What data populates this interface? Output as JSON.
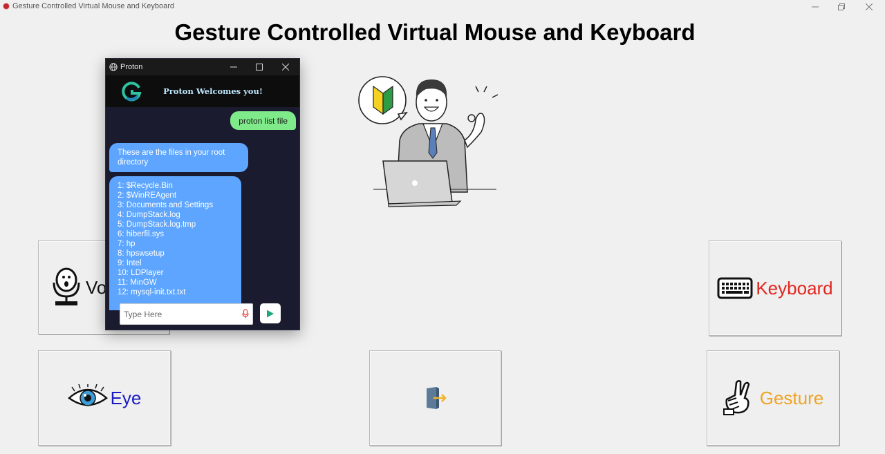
{
  "window": {
    "title": "Gesture Controlled Virtual Mouse and Keyboard",
    "controls": [
      "minimize",
      "restore",
      "close"
    ]
  },
  "main": {
    "heading": "Gesture Controlled Virtual Mouse and Keyboard",
    "tiles": {
      "voice": {
        "label": "Vo",
        "icon": "microphone-icon"
      },
      "keyboard": {
        "label": "Keyboard",
        "icon": "keyboard-icon",
        "color": "#e3261f"
      },
      "eye": {
        "label": "Eye",
        "icon": "eye-icon",
        "color": "#1c1cc4"
      },
      "exit": {
        "label": "",
        "icon": "exit-door-icon"
      },
      "gesture": {
        "label": "Gesture",
        "icon": "victory-hand-icon",
        "color": "#f0a323"
      }
    }
  },
  "chat": {
    "window_title": "Proton",
    "welcome": "Proton Welcomes you!",
    "messages": {
      "user": "proton list file",
      "bot_intro": "These are the files in your root directory",
      "files": [
        "1: $Recycle.Bin",
        "2: $WinREAgent",
        "3: Documents and Settings",
        "4: DumpStack.log",
        "5: DumpStack.log.tmp",
        "6: hiberfil.sys",
        "7: hp",
        "8: hpswsetup",
        "9: Intel",
        "10: LDPlayer",
        "11: MinGW",
        "12: mysql-init.txt.txt"
      ]
    },
    "input": {
      "placeholder": "Type Here",
      "value": ""
    },
    "colors": {
      "user_bubble": "#7fea8a",
      "bot_bubble": "#5da5ff",
      "background": "#1b1b2f"
    }
  }
}
